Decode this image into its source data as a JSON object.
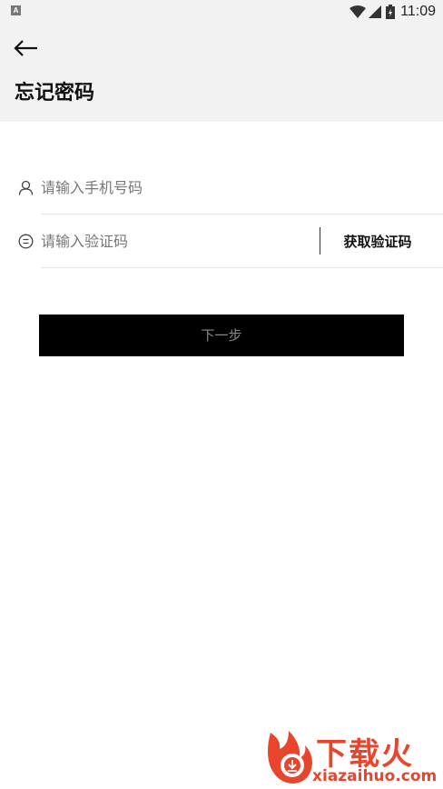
{
  "status_bar": {
    "app_icon_letter": "A",
    "time": "11:09"
  },
  "header": {
    "title": "忘记密码"
  },
  "form": {
    "phone_placeholder": "请输入手机号码",
    "code_placeholder": "请输入验证码",
    "get_code_label": "获取验证码",
    "next_label": "下一步"
  },
  "watermark": {
    "title": "下载火",
    "domain": "xiazaihuo.com"
  },
  "colors": {
    "header_bg": "#f2f2f2",
    "button_bg": "#000000",
    "button_text": "#8a8a8a",
    "watermark": "#e8452c"
  }
}
